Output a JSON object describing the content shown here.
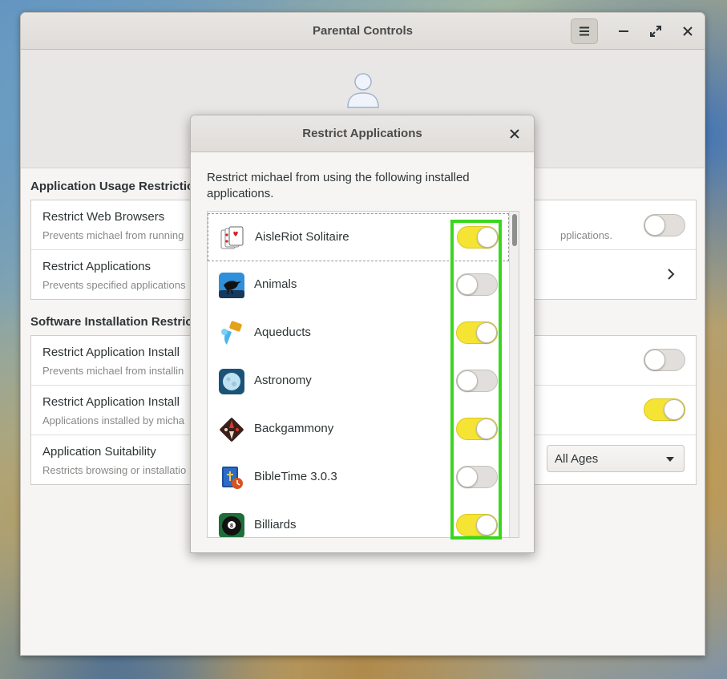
{
  "window": {
    "title": "Parental Controls",
    "menu_icon": "hamburger-menu-icon",
    "minimize_icon": "minimize-icon",
    "maximize_icon": "maximize-icon",
    "close_icon": "close-icon"
  },
  "user": {
    "avatar_icon": "user-avatar-icon"
  },
  "usage_section": {
    "heading": "Application Usage Restrictio",
    "rows": [
      {
        "title": "Restrict Web Browsers",
        "subtitle": "Prevents michael from running",
        "subtitle_right": "pplications.",
        "control": "switch",
        "state": "off"
      },
      {
        "title": "Restrict Applications",
        "subtitle": "Prevents specified applications",
        "control": "chevron"
      }
    ]
  },
  "install_section": {
    "heading": "Software Installation Restric",
    "rows": [
      {
        "title": "Restrict Application Install",
        "subtitle": "Prevents michael from installin",
        "control": "switch",
        "state": "off"
      },
      {
        "title": "Restrict Application Install",
        "subtitle": "Applications installed by micha",
        "control": "switch",
        "state": "on"
      },
      {
        "title": "Application Suitability",
        "subtitle": "Restricts browsing or installatio",
        "control": "dropdown",
        "dropdown_value": "All Ages"
      }
    ]
  },
  "dialog": {
    "title": "Restrict Applications",
    "close_icon": "close-icon",
    "description": "Restrict michael from using the following installed applications.",
    "apps": [
      {
        "name": "AisleRiot Solitaire",
        "icon": "solitaire-cards-icon",
        "enabled": true
      },
      {
        "name": "Animals",
        "icon": "crow-icon",
        "enabled": false
      },
      {
        "name": "Aqueducts",
        "icon": "water-pipe-icon",
        "enabled": true
      },
      {
        "name": "Astronomy",
        "icon": "moon-icon",
        "enabled": false
      },
      {
        "name": "Backgammony",
        "icon": "backgammon-board-icon",
        "enabled": true
      },
      {
        "name": "BibleTime 3.0.3",
        "icon": "bible-book-icon",
        "enabled": false
      },
      {
        "name": "Billiards",
        "icon": "eight-ball-icon",
        "enabled": true
      }
    ]
  },
  "colors": {
    "switch_on": "#f5e433",
    "switch_off": "#e1dedb",
    "highlight": "#3ad61e"
  }
}
